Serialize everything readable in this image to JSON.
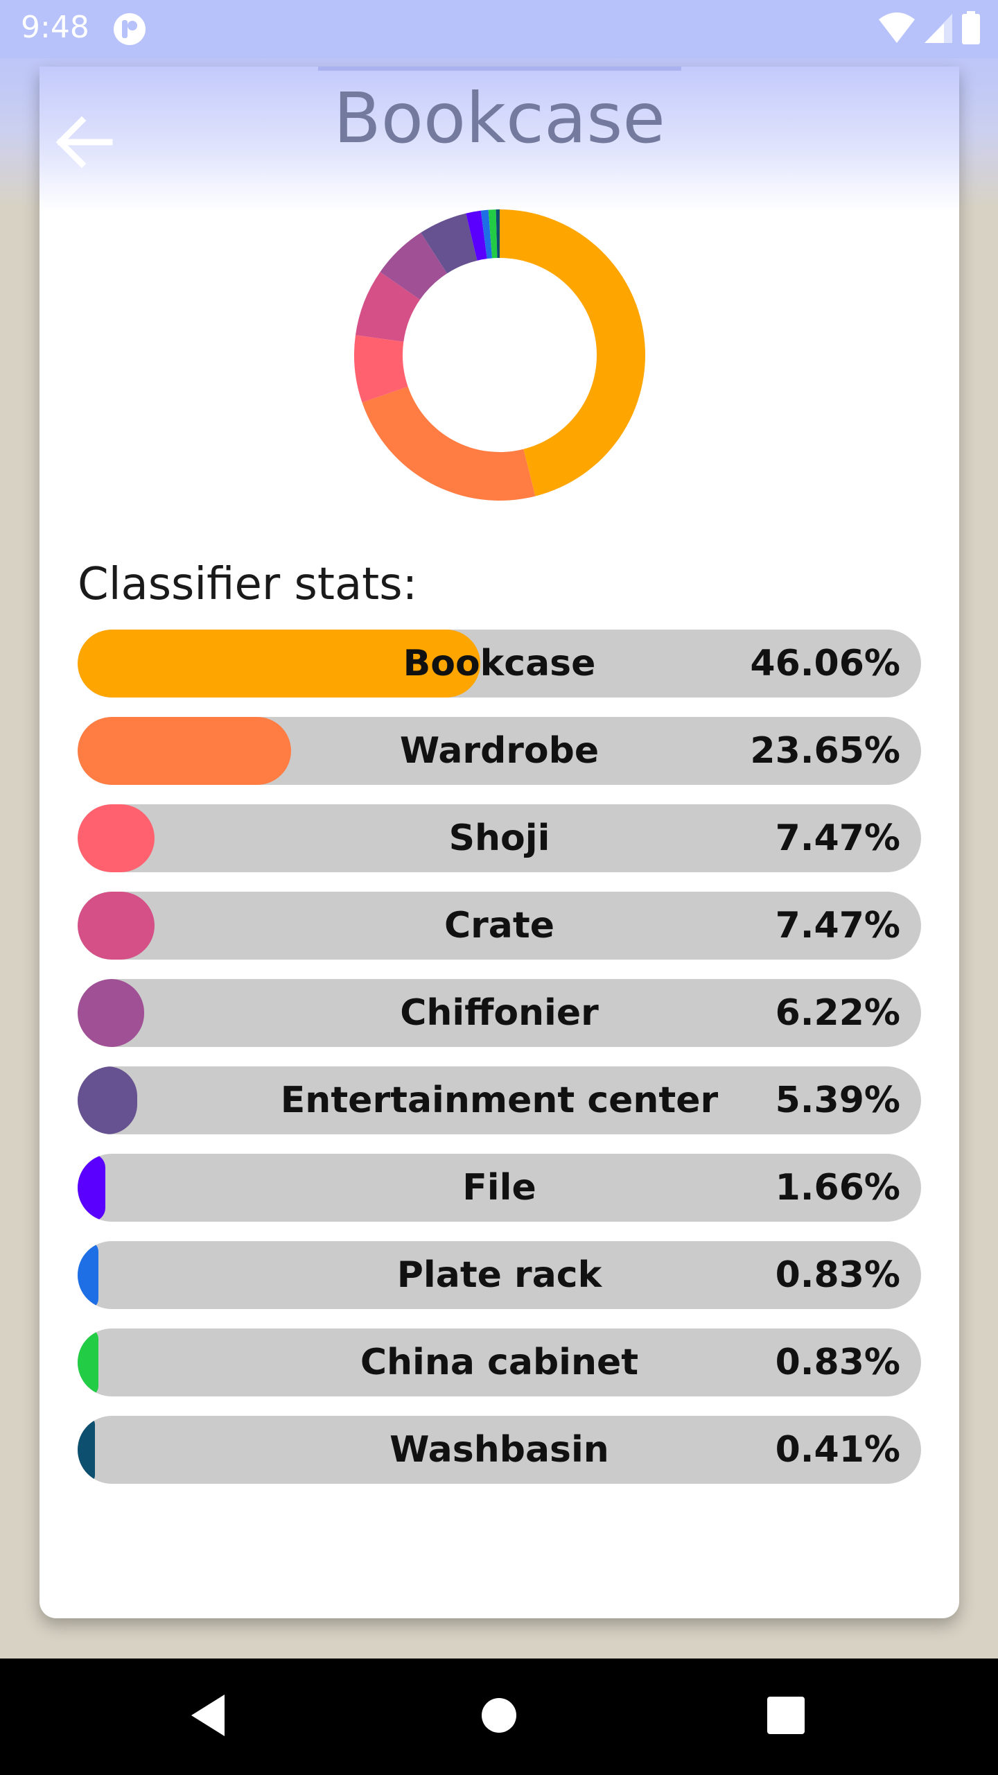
{
  "status_bar": {
    "time": "9:48",
    "icons": [
      "app-notification-icon",
      "wifi-icon",
      "signal-icon",
      "battery-icon"
    ]
  },
  "header": {
    "title": "Bookcase",
    "back_icon": "arrow-left-icon"
  },
  "stats_heading": "Classifier stats:",
  "stats": [
    {
      "label": "Bookcase",
      "value": "46.06%",
      "percent": 46.06,
      "color": "#ffa500"
    },
    {
      "label": "Wardrobe",
      "value": "23.65%",
      "percent": 23.65,
      "color": "#ff7c43"
    },
    {
      "label": "Shoji",
      "value": "7.47%",
      "percent": 7.47,
      "color": "#ff616f"
    },
    {
      "label": "Crate",
      "value": "7.47%",
      "percent": 7.47,
      "color": "#d45087"
    },
    {
      "label": "Chiffonier",
      "value": "6.22%",
      "percent": 6.22,
      "color": "#a05195"
    },
    {
      "label": "Entertainment center",
      "value": "5.39%",
      "percent": 5.39,
      "color": "#665191"
    },
    {
      "label": "File",
      "value": "1.66%",
      "percent": 1.66,
      "color": "#5a00ff"
    },
    {
      "label": "Plate rack",
      "value": "0.83%",
      "percent": 0.83,
      "color": "#1e6fe6"
    },
    {
      "label": "China cabinet",
      "value": "0.83%",
      "percent": 0.83,
      "color": "#22cc44"
    },
    {
      "label": "Washbasin",
      "value": "0.41%",
      "percent": 0.41,
      "color": "#0d4f6e"
    }
  ],
  "nav_bar": {
    "buttons": [
      "back-triangle-icon",
      "home-circle-icon",
      "recents-square-icon"
    ]
  },
  "colors": {
    "card_header_top": "#c3cafb",
    "stat_track": "#cbcbcb",
    "nav_bar": "#000000"
  }
}
